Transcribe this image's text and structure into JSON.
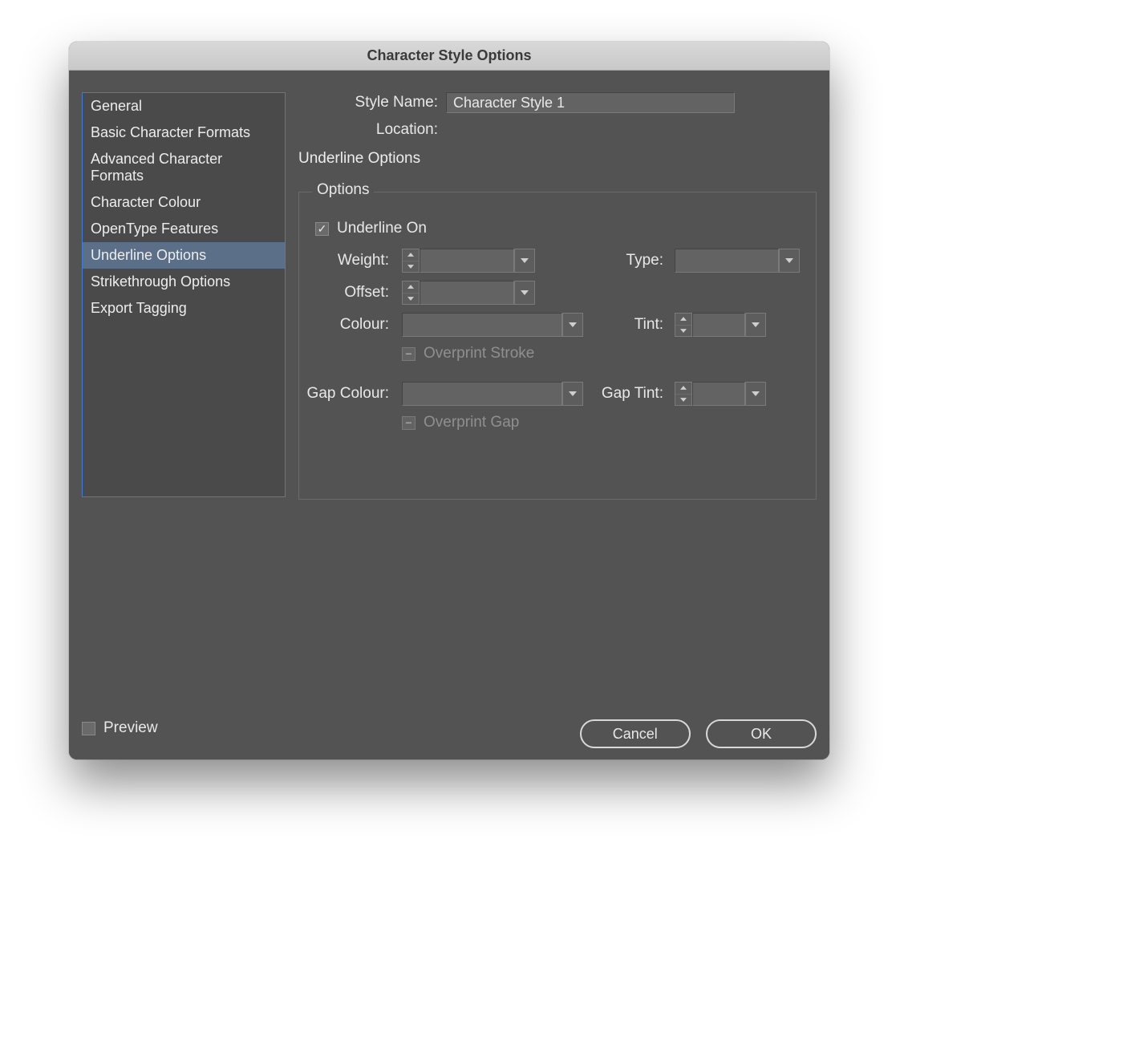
{
  "titlebar": {
    "title": "Character Style Options"
  },
  "sidebar": {
    "items": [
      {
        "label": "General"
      },
      {
        "label": "Basic Character Formats"
      },
      {
        "label": "Advanced Character Formats"
      },
      {
        "label": "Character Colour"
      },
      {
        "label": "OpenType Features"
      },
      {
        "label": "Underline Options"
      },
      {
        "label": "Strikethrough Options"
      },
      {
        "label": "Export Tagging"
      }
    ],
    "selected_index": 5
  },
  "header": {
    "style_name_label": "Style Name:",
    "style_name_value": "Character Style 1",
    "location_label": "Location:"
  },
  "section": {
    "title": "Underline Options"
  },
  "group": {
    "legend": "Options",
    "underline_on_label": "Underline On",
    "underline_on_checked": true,
    "weight_label": "Weight:",
    "weight_value": "",
    "type_label": "Type:",
    "type_value": "",
    "offset_label": "Offset:",
    "offset_value": "",
    "colour_label": "Colour:",
    "colour_value": "",
    "tint_label": "Tint:",
    "tint_value": "",
    "overprint_stroke_label": "Overprint Stroke",
    "gap_colour_label": "Gap Colour:",
    "gap_colour_value": "",
    "gap_tint_label": "Gap Tint:",
    "gap_tint_value": "",
    "overprint_gap_label": "Overprint Gap"
  },
  "footer": {
    "preview_label": "Preview",
    "preview_checked": false,
    "cancel_label": "Cancel",
    "ok_label": "OK"
  }
}
